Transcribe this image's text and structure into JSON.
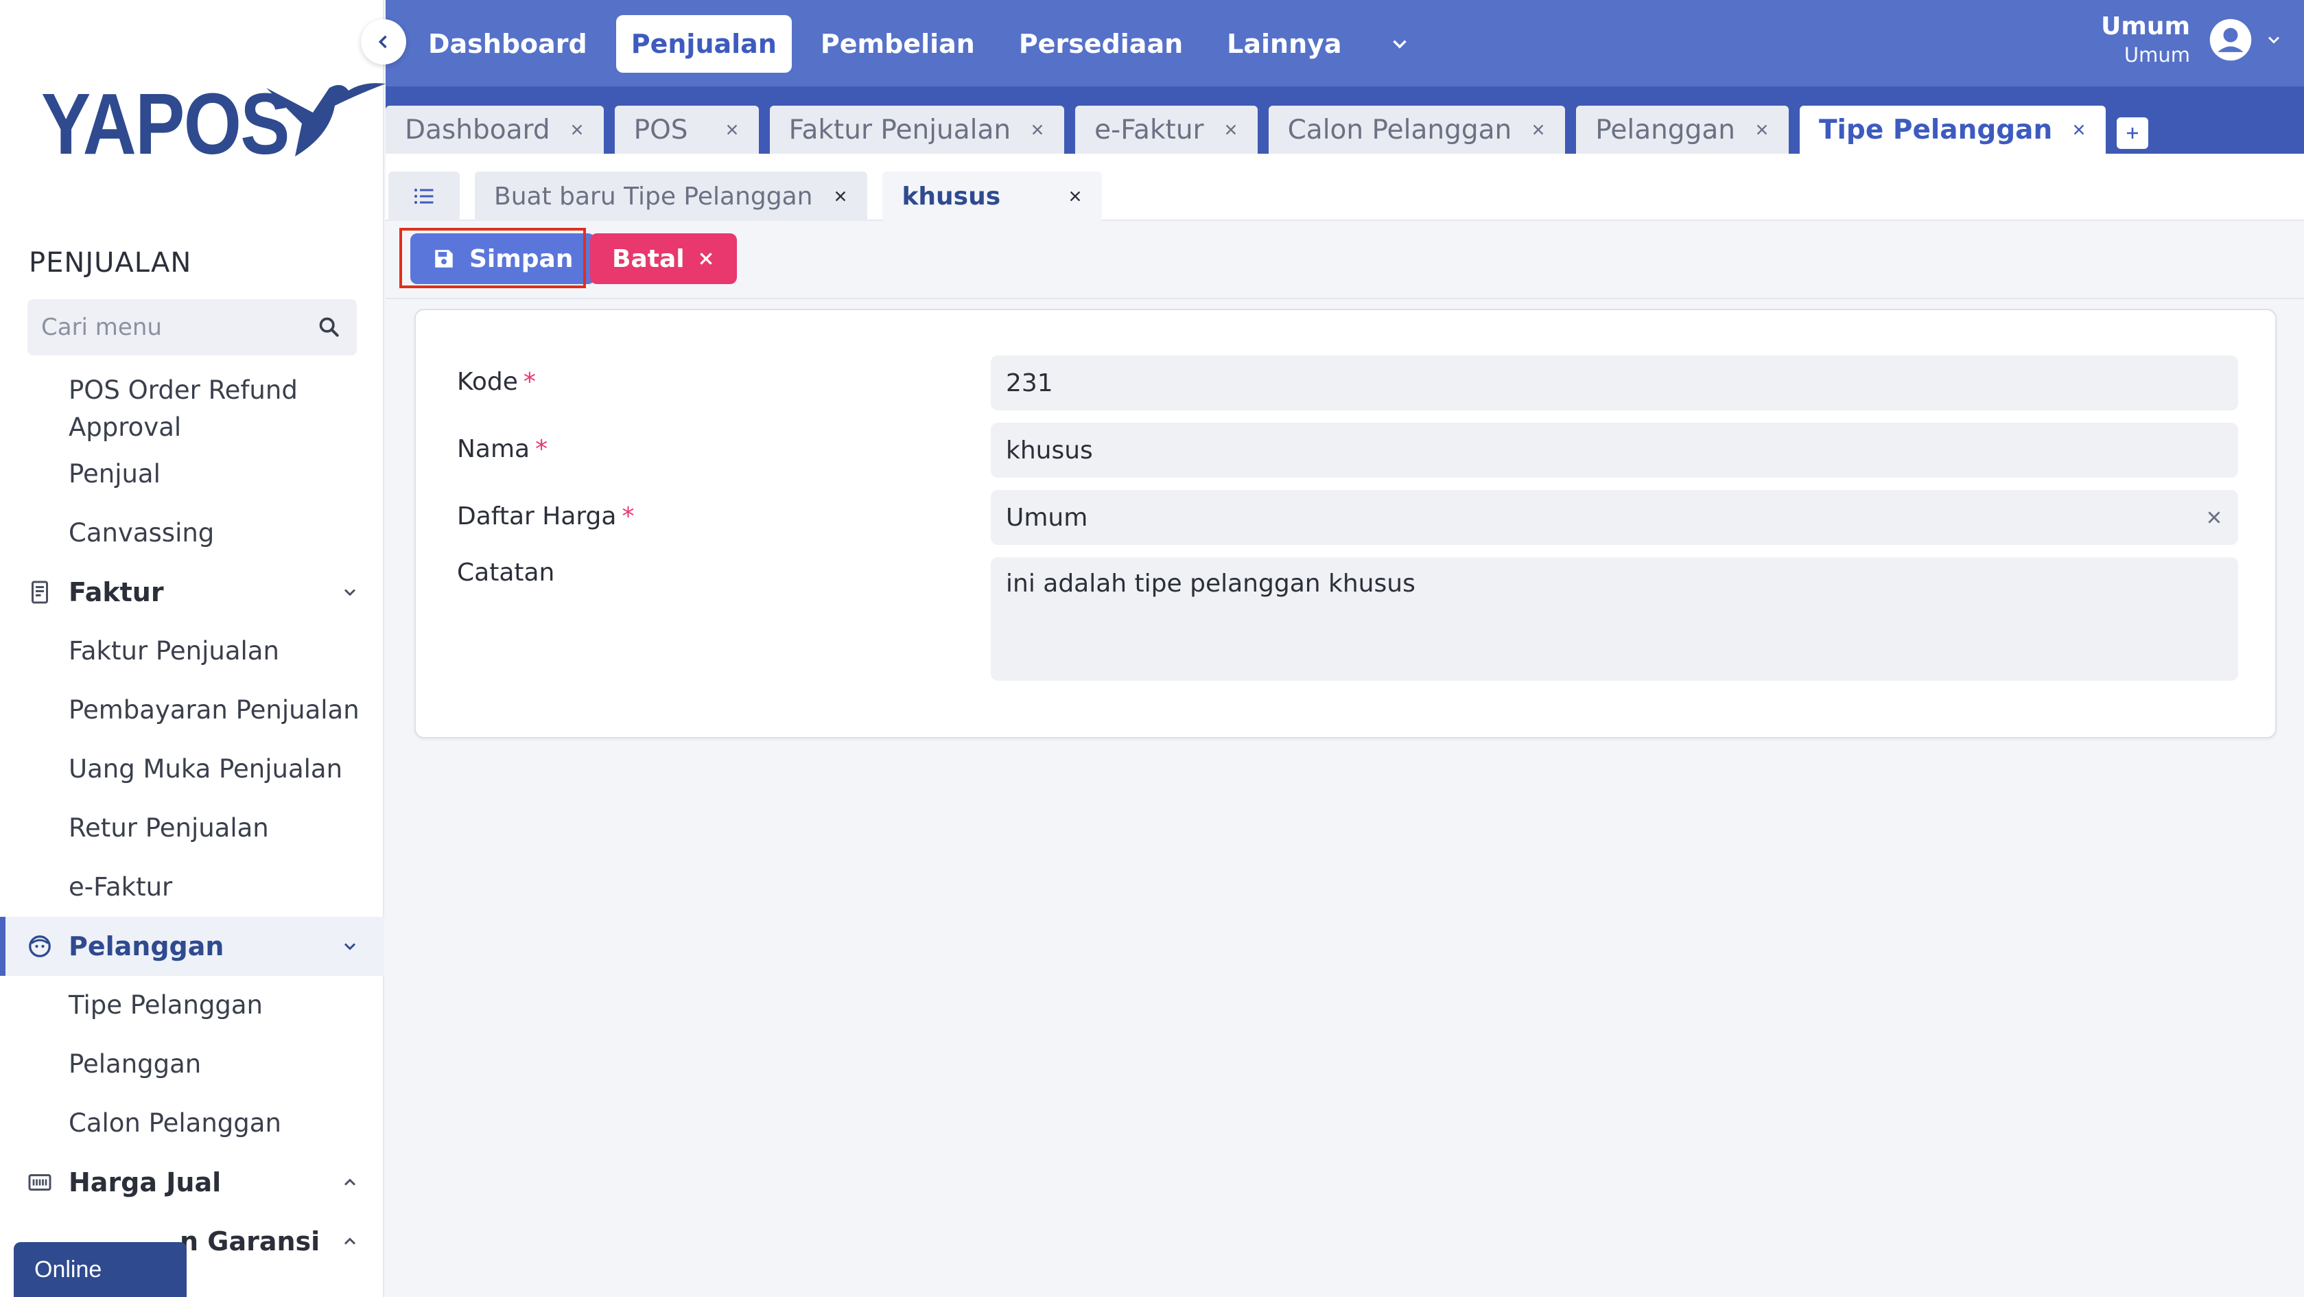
{
  "sidebar": {
    "logo_text": "YAPOS",
    "section_title": "PENJUALAN",
    "search_placeholder": "Cari menu",
    "items_top": [
      "POS Order Refund Approval",
      "Penjual",
      "Canvassing"
    ],
    "faktur_group": {
      "label": "Faktur",
      "items": [
        "Faktur Penjualan",
        "Pembayaran Penjualan",
        "Uang Muka Penjualan",
        "Retur Penjualan",
        "e-Faktur"
      ]
    },
    "pelanggan_group": {
      "label": "Pelanggan",
      "items": [
        "Tipe Pelanggan",
        "Pelanggan",
        "Calon Pelanggan"
      ]
    },
    "harga_group": {
      "label": "Harga Jual"
    },
    "garansi_group": {
      "label": "n Garansi"
    },
    "online_badge": "Online"
  },
  "topnav": {
    "items": [
      "Dashboard",
      "Penjualan",
      "Pembelian",
      "Persediaan",
      "Lainnya"
    ],
    "active_index": 1
  },
  "user": {
    "name": "Umum",
    "sub": "Umum"
  },
  "doc_tabs": {
    "items": [
      "Dashboard",
      "POS",
      "Faktur Penjualan",
      "e-Faktur",
      "Calon Pelanggan",
      "Pelanggan",
      "Tipe Pelanggan"
    ],
    "active_index": 6
  },
  "sub_tabs": {
    "items": [
      "Buat baru Tipe Pelanggan",
      "khusus"
    ],
    "active_index": 1
  },
  "actions": {
    "save_label": "Simpan",
    "cancel_label": "Batal"
  },
  "form": {
    "kode": {
      "label": "Kode",
      "value": "231"
    },
    "nama": {
      "label": "Nama",
      "value": "khusus"
    },
    "daftar_harga": {
      "label": "Daftar Harga",
      "value": "Umum"
    },
    "catatan": {
      "label": "Catatan",
      "value": "ini adalah tipe pelanggan khusus"
    },
    "required_mark": "*"
  },
  "colors": {
    "topbar": "#5571c8",
    "tabbar": "#3f5ab5",
    "brand": "#2f4a8f",
    "save": "#5b76db",
    "cancel": "#e8386e",
    "highlight": "#e0301e"
  }
}
